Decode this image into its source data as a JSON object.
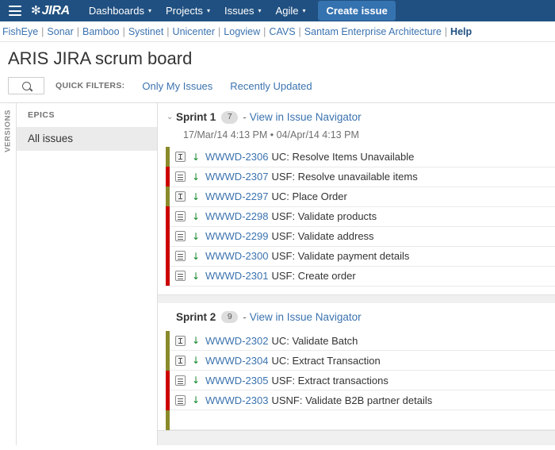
{
  "topnav": {
    "menu_icon": "hamburger-icon",
    "logo_mark": "✻",
    "logo_text": "JIRA",
    "items": [
      {
        "label": "Dashboards",
        "caret": "▾"
      },
      {
        "label": "Projects",
        "caret": "▾"
      },
      {
        "label": "Issues",
        "caret": "▾"
      },
      {
        "label": "Agile",
        "caret": "▾"
      }
    ],
    "create_button": "Create issue"
  },
  "linkbar": {
    "links": [
      "FishEye",
      "Sonar",
      "Bamboo",
      "Systinet",
      "Unicenter",
      "Logview",
      "CAVS",
      "Santam Enterprise Architecture"
    ],
    "help": "Help",
    "separator": "|"
  },
  "board": {
    "title": "ARIS JIRA scrum board",
    "search_placeholder": "",
    "search_value": "",
    "search_icon": "search-icon",
    "quick_filters_label": "QUICK FILTERS:",
    "quick_filters": [
      "Only My Issues",
      "Recently Updated"
    ]
  },
  "versions_rail": {
    "label": "VERSIONS"
  },
  "epics": {
    "header": "EPICS",
    "items": [
      {
        "label": "All issues",
        "selected": true
      }
    ]
  },
  "sprints": [
    {
      "name": "Sprint 1",
      "count": "7",
      "dash": "-",
      "nav_link": "View in Issue Navigator",
      "dates": "17/Mar/14 4:13 PM • 04/Apr/14 4:13 PM",
      "chevron": "⌄",
      "show_chevron": true,
      "issues": [
        {
          "key": "WWWD-2306",
          "summary": "UC: Resolve Items Unavailable",
          "type": "uc",
          "bar_color": "#8a8a2a",
          "priority": "↓"
        },
        {
          "key": "WWWD-2307",
          "summary": "USF: Resolve unavailable items",
          "type": "usf",
          "bar_color": "#cc0000",
          "priority": "↓"
        },
        {
          "key": "WWWD-2297",
          "summary": "UC: Place Order",
          "type": "uc",
          "bar_color": "#8a8a2a",
          "priority": "↓"
        },
        {
          "key": "WWWD-2298",
          "summary": "USF: Validate products",
          "type": "usf",
          "bar_color": "#cc0000",
          "priority": "↓"
        },
        {
          "key": "WWWD-2299",
          "summary": "USF: Validate address",
          "type": "usf",
          "bar_color": "#cc0000",
          "priority": "↓"
        },
        {
          "key": "WWWD-2300",
          "summary": "USF: Validate payment details",
          "type": "usf",
          "bar_color": "#cc0000",
          "priority": "↓"
        },
        {
          "key": "WWWD-2301",
          "summary": "USF: Create order",
          "type": "usf",
          "bar_color": "#cc0000",
          "priority": "↓"
        }
      ]
    },
    {
      "name": "Sprint 2",
      "count": "9",
      "dash": "-",
      "nav_link": "View in Issue Navigator",
      "dates": "",
      "chevron": "⌄",
      "show_chevron": false,
      "issues": [
        {
          "key": "WWWD-2302",
          "summary": "UC: Validate Batch",
          "type": "uc",
          "bar_color": "#8a8a2a",
          "priority": "↓"
        },
        {
          "key": "WWWD-2304",
          "summary": "UC: Extract Transaction",
          "type": "uc",
          "bar_color": "#8a8a2a",
          "priority": "↓"
        },
        {
          "key": "WWWD-2305",
          "summary": "USF: Extract transactions",
          "type": "usf",
          "bar_color": "#cc0000",
          "priority": "↓"
        },
        {
          "key": "WWWD-2303",
          "summary": "USNF: Validate B2B partner details",
          "type": "usf",
          "bar_color": "#cc0000",
          "priority": "↓"
        }
      ]
    }
  ],
  "colors": {
    "nav_blue": "#205081",
    "create_blue": "#3572b0",
    "link_blue": "#3b73af",
    "priority_green": "#14892c",
    "epic_red": "#cc0000",
    "epic_olive": "#8a8a2a"
  }
}
